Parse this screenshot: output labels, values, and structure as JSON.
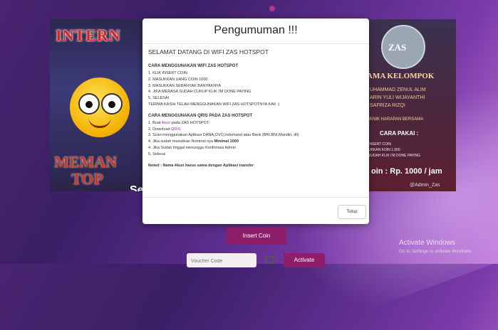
{
  "background": {
    "accent": "#8e1e6a"
  },
  "left_banner": {
    "title": "INTERN",
    "word1": "MEMAN",
    "word2": "TOP",
    "tail": "Se"
  },
  "right_banner": {
    "logo_text": "ZAS",
    "heading": "AMA KELOMPOK",
    "names": [
      "UHAMMAD ZENUL ALIM",
      "ARIN YULI WIJAYANTHI",
      "SAFRIZA RIZQI"
    ],
    "team": "EKNIK HARAPAN BERSAMA",
    "cara": "CARA PAKAI :",
    "steps": [
      "INSERT COIN",
      "UKKAN KOIN 1.000",
      "SUDAH KLIK I'M DONE PAYING"
    ],
    "price": "oin : Rp. 1000 / jam",
    "admin": "@Admin_Zas"
  },
  "modal": {
    "title": "Pengumuman !!!",
    "welcome": "SELAMAT DATANG DI WIFI ZAS HOTSPOT",
    "section1_title": "CARA MENGGUNAKAN WIFI ZAS HOTSPOT",
    "section1_lines": [
      "1. KLIK INSERT COIN",
      "2. MASUKKAN UANG COIN 1000",
      "3. MASUKKAN SEBANYAK BANYAKNYA",
      "4. JIKA MERASA SUDAH CUKUP KLIK I'M DONE PAYING",
      "5. SELESAI",
      "TERIMA KASIH TELAH MENGGUNAKAN WIFI ZAS HOTSPOTNYA KAK :)"
    ],
    "section2_title": "CARA MENGGUNAKAN QRIS PADA ZAS HOTSPOT",
    "s2": {
      "l1_pre": "1. Buat ",
      "l1_link": "Akun",
      "l1_post": " pada ZAS HOTSPOT",
      "l2_pre": "2. Download ",
      "l2_link": "QRIS",
      "l3": "3. Scan menggunakan Aplikasi DANA,OVO,Indomaret atau Bank (BRI,BNI,Mandiri, dll)",
      "l4_pre": "4. Jika sudah masukkan Nominal nya ",
      "l4_bold": "Minimal 1000",
      "l5": "4. Jika Sudah tinggal menunggu Konfirmasi Admin",
      "l6": "5. Selesai"
    },
    "note": "Noted : Nama Akun harus sama dengan Aplikasi transfer",
    "close_label": "Tutup"
  },
  "insert_coin_label": "Insert Coin",
  "voucher": {
    "placeholder": "Voucher Code"
  },
  "activate_label": "Activate",
  "windows_watermark": {
    "title": "Activate Windows",
    "subtitle": "Go to Settings to activate Windows."
  }
}
